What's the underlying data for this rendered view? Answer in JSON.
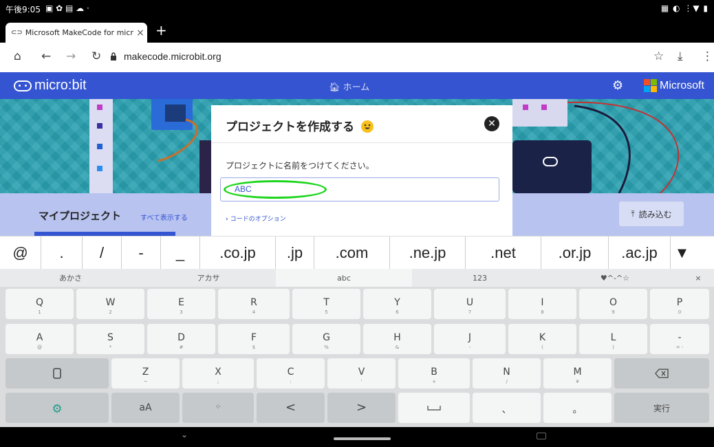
{
  "status": {
    "time": "午後9:05"
  },
  "tab": {
    "title": "Microsoft MakeCode for micr",
    "close": "×",
    "new": "+"
  },
  "omnibox": {
    "url": "makecode.microbit.org"
  },
  "header": {
    "logo": "micro:bit",
    "home": "ホーム",
    "brand": "Microsoft",
    "colors": {
      "bar": "#3454d1",
      "ms_red": "#f25022",
      "ms_green": "#7fba00",
      "ms_blue": "#00a4ef",
      "ms_yellow": "#ffb900"
    }
  },
  "projects": {
    "title": "マイプロジェクト",
    "show_all": "すべて表示する",
    "import": "読み込む"
  },
  "dialog": {
    "title": "プロジェクトを作成する",
    "prompt": "プロジェクトに名前をつけてください。",
    "input_value": "ABC",
    "options": "コードのオプション"
  },
  "suggestions": [
    "@",
    ".",
    "/",
    "-",
    "_",
    ".co.jp",
    ".jp",
    ".com",
    ".ne.jp",
    ".net",
    ".or.jp",
    ".ac.jp"
  ],
  "modes": [
    "あかさ",
    "アカサ",
    "abc",
    "123",
    "♥^-^☆",
    "×"
  ],
  "keyboard": {
    "row1": [
      {
        "k": "Q",
        "s": "1"
      },
      {
        "k": "W",
        "s": "2"
      },
      {
        "k": "E",
        "s": "3"
      },
      {
        "k": "R",
        "s": "4"
      },
      {
        "k": "T",
        "s": "5"
      },
      {
        "k": "Y",
        "s": "6"
      },
      {
        "k": "U",
        "s": "7"
      },
      {
        "k": "I",
        "s": "8"
      },
      {
        "k": "O",
        "s": "9"
      },
      {
        "k": "P",
        "s": "0"
      }
    ],
    "row2": [
      {
        "k": "A",
        "s": "@"
      },
      {
        "k": "S",
        "s": "*"
      },
      {
        "k": "D",
        "s": "#"
      },
      {
        "k": "F",
        "s": "$"
      },
      {
        "k": "G",
        "s": "%"
      },
      {
        "k": "H",
        "s": "&"
      },
      {
        "k": "J",
        "s": "-"
      },
      {
        "k": "K",
        "s": "("
      },
      {
        "k": "L",
        "s": ")"
      },
      {
        "k": "-",
        "s": "= -"
      }
    ],
    "row3": [
      {
        "k": "Z",
        "s": "~"
      },
      {
        "k": "X",
        "s": ";"
      },
      {
        "k": "C",
        "s": ":"
      },
      {
        "k": "V",
        "s": "'"
      },
      {
        "k": "B",
        "s": "+"
      },
      {
        "k": "N",
        "s": "/"
      },
      {
        "k": "M",
        "s": "¥"
      }
    ],
    "row4": [
      "aA",
      "<",
      ">",
      "、",
      "。"
    ],
    "enter": "実行"
  }
}
